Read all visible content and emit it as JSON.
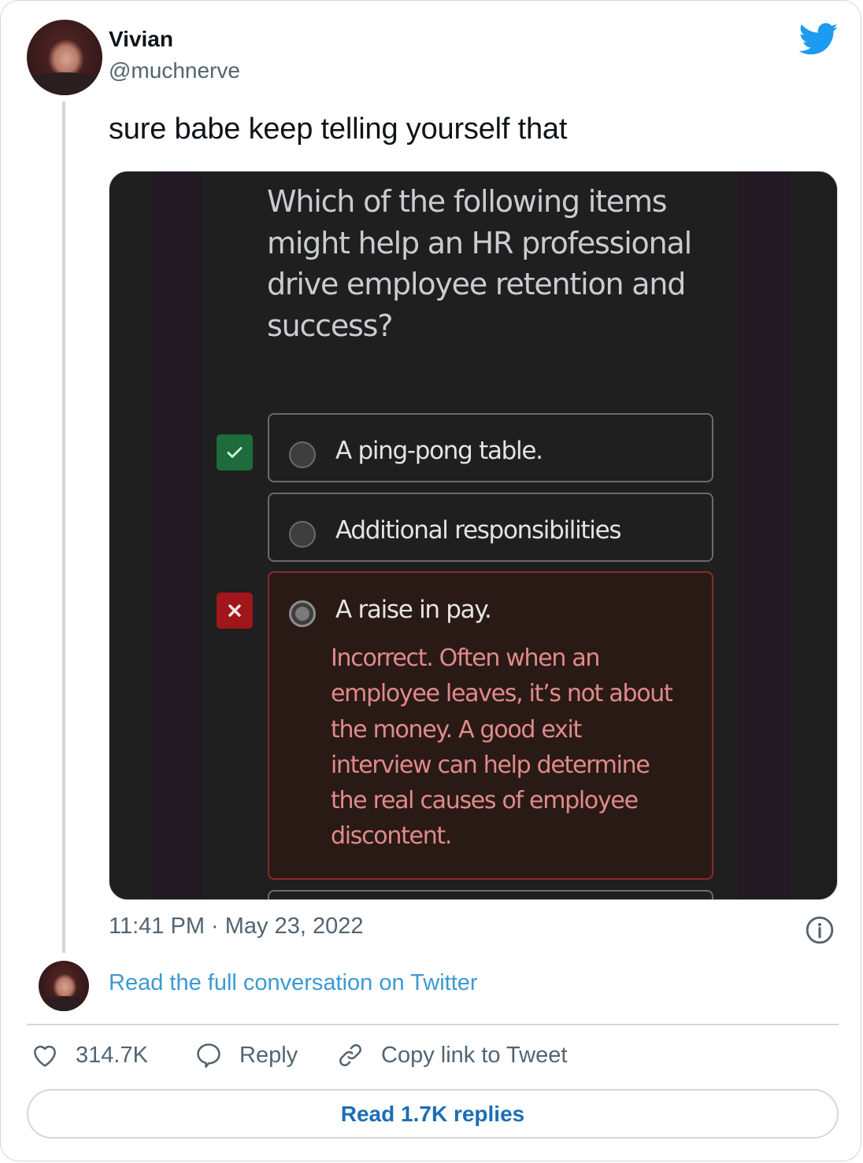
{
  "author": {
    "name": "Vivian",
    "handle": "@muchnerve"
  },
  "tweet": {
    "text": "sure babe keep telling yourself that",
    "timestamp": "11:41 PM · May 23, 2022"
  },
  "media": {
    "question": "Which of the following items might help an HR professional drive employee retention and success?",
    "options": [
      {
        "label": "A ping-pong table.",
        "status": "correct",
        "status_icon": "check-icon"
      },
      {
        "label": "Additional responsibilities",
        "status": "none"
      },
      {
        "label": "A raise in pay.",
        "status": "incorrect",
        "status_icon": "x-icon",
        "selected": true,
        "feedback": "Incorrect. Often when an employee leaves, it’s not about the money. A good exit interview can help determine the real causes of employee discontent."
      }
    ],
    "colors": {
      "background": "#1f1f1f",
      "correct": "#1e6b3c",
      "incorrect": "#a0161a",
      "feedback_text": "#e08a8a"
    }
  },
  "footer": {
    "read_conversation": "Read the full conversation on Twitter",
    "likes": "314.7K",
    "reply_label": "Reply",
    "copy_link_label": "Copy link to Tweet",
    "read_replies": "Read 1.7K replies"
  },
  "icons": {
    "brand": "twitter-bird-icon",
    "info": "info-icon",
    "like": "heart-icon",
    "reply": "speech-bubble-icon",
    "copy": "link-icon"
  },
  "colors": {
    "brand": "#1d9bf0",
    "link": "#3b9ad4",
    "secondary_text": "#536471",
    "primary_text": "#0f1419"
  }
}
